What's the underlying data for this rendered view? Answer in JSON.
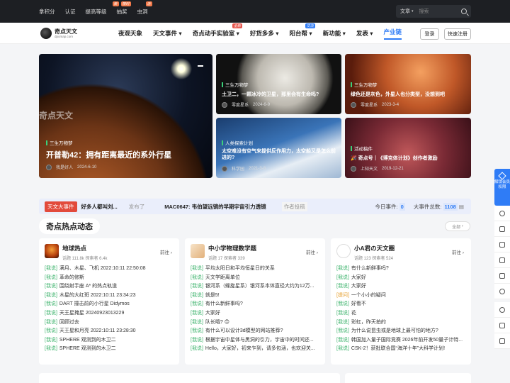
{
  "topbar": {
    "links": [
      "拿积分",
      "认证",
      "提高等级",
      "抽奖",
      "虫洞"
    ],
    "mini_badges": [
      "新",
      "限时",
      "活"
    ],
    "search_select": "文章",
    "search_placeholder": "搜索"
  },
  "nav": {
    "logo_title": "奇点天文",
    "logo_sub": "dpomap.com",
    "items": [
      {
        "label": "夜观天象"
      },
      {
        "label": "天文事件"
      },
      {
        "label": "奇点动手实验室",
        "tag": "全新"
      },
      {
        "label": "好货多多"
      },
      {
        "label": "阳台帮",
        "tag": "交流"
      },
      {
        "label": "新功能"
      },
      {
        "label": "发表"
      },
      {
        "label": "产业链"
      }
    ],
    "login": "登录",
    "register": "快速注册"
  },
  "banners": {
    "main": {
      "watermark": "奇点天文",
      "cat": "三生万物梦",
      "title": "开普勒42：拥有距离最近的系外行星",
      "author": "我是好人",
      "date": "2024-6-10"
    },
    "b1": {
      "cat": "三生万物梦",
      "title": "土卫二，一颗冰冷的卫星，那里会有生命吗?",
      "author": "零度星系",
      "date": "2024-6-9"
    },
    "b2": {
      "cat": "三生万物梦",
      "title": "绿色还是灰色，外星人也分类型，没想到吧",
      "author": "零度星系",
      "date": "2023-3-4"
    },
    "b3": {
      "cat": "人类探索计划",
      "title": "太空难没有空气来提供反作用力，太空船又是怎么前进的?",
      "author": "科学园",
      "date": "2021-3-8"
    },
    "b4": {
      "cat": "活动稿件",
      "title": "🎉 奇点号｜《博克体计划》创作者激励",
      "author": "上知天文",
      "date": "2019-12-21"
    }
  },
  "ticker": {
    "label": "天文大事件",
    "text": "好多人都叫刘...",
    "grey": "发布了",
    "item": "MAC0647: 韦伯望远镜的早期宇宙引力透镜",
    "grey2": "作者投稿",
    "today_label": "今日事件:",
    "today_value": "0",
    "total_label": "大事件总数:",
    "total_value": "1108"
  },
  "section": {
    "title": "奇点热点动态",
    "all": "全部"
  },
  "columns": [
    {
      "name": "地球热点",
      "stats": "话题 111.8k  探索者 6.4k",
      "go": "前往",
      "posts": [
        {
          "k": "[我说]",
          "t": "满月、木星、飞机 2022:10:11 22:50:08"
        },
        {
          "k": "[我说]",
          "t": "革命的修斯"
        },
        {
          "k": "[我说]",
          "t": "围绕射手座 A* 的热点轨道"
        },
        {
          "k": "[我说]",
          "t": "木星的大红斑 2022:10:11 23:34:23"
        },
        {
          "k": "[我说]",
          "t": "DART 撞击前的小行星 Didymos"
        },
        {
          "k": "[我说]",
          "t": "天王星掩星 20240923013229"
        },
        {
          "k": "[我说]",
          "t": "回顾过去"
        },
        {
          "k": "[我说]",
          "t": "天王星和月亮 2022:10:11 23:28:30"
        },
        {
          "k": "[我说]",
          "t": "SPHERE 观测到的木卫二"
        },
        {
          "k": "[我说]",
          "t": "SPHERE 观测到的木卫二"
        }
      ]
    },
    {
      "name": "中小学物理数学题",
      "stats": "话题 17  探索者 339",
      "go": "前往",
      "posts": [
        {
          "k": "[我说]",
          "t": "平均太阳日和平均恒星日的关系"
        },
        {
          "k": "[我说]",
          "t": "天文学距离单位"
        },
        {
          "k": "[我说]",
          "t": "银河系（蝶旋星系）银河系本体直径大约为12万..."
        },
        {
          "k": "[我说]",
          "t": "就是5!"
        },
        {
          "k": "[我说]",
          "t": "有什么新鲜事吗?"
        },
        {
          "k": "[我说]",
          "t": "大家好"
        },
        {
          "k": "[我说]",
          "t": "队长哦? 😊"
        },
        {
          "k": "[我说]",
          "t": "有什么可以设计3d模型的网站推荐?"
        },
        {
          "k": "[我说]",
          "t": "根据宇宙中星体与黑洞的引力，宇宙中的时间还..."
        },
        {
          "k": "[我说]",
          "t": "Hello，大家好，初来乍到，请多包涵，也欢迎关..."
        }
      ]
    },
    {
      "name": "小A君の天文圈",
      "stats": "话题 123  探索者 524",
      "go": "前往",
      "posts": [
        {
          "k": "[我说]",
          "t": "有什么新鲜事吗?"
        },
        {
          "k": "[我说]",
          "t": "大家好"
        },
        {
          "k": "[我说]",
          "t": "大家好"
        },
        {
          "k": "[提问]",
          "t": "一个小小的疑问"
        },
        {
          "k": "[我说]",
          "t": "好看不"
        },
        {
          "k": "[我说]",
          "t": "花"
        },
        {
          "k": "[我说]",
          "t": "彩虹，昨天拍的"
        },
        {
          "k": "[我说]",
          "t": "为什么说昆虫或是地球上最可怕的地方?"
        },
        {
          "k": "[我说]",
          "t": "韩国加入量子国际竞赛 2026年前开发50量子计特..."
        },
        {
          "k": "[我说]",
          "t": "CSK-2！获批联合国“海洋十年”大科学计划!"
        }
      ]
    }
  ],
  "float_side": {
    "vip": "解锁会员权限"
  },
  "colors": {
    "accent": "#2f7cf6",
    "topbar": "#1d1f23",
    "ticker_label": "#e24a3b"
  }
}
